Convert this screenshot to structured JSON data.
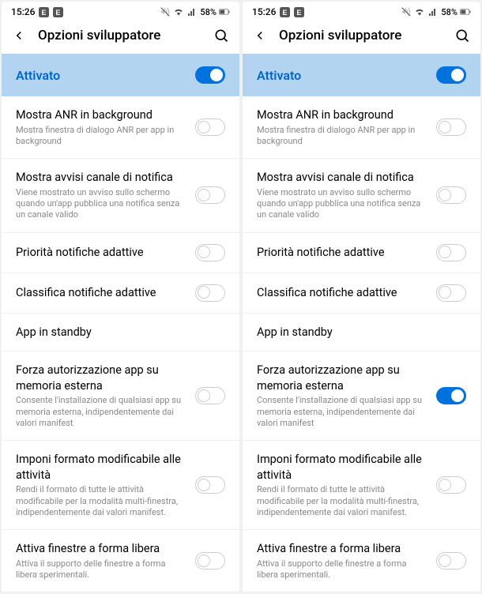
{
  "status": {
    "time": "15:26",
    "battery": "58%"
  },
  "header": {
    "title": "Opzioni sviluppatore"
  },
  "activated": {
    "label": "Attivato"
  },
  "settings": [
    {
      "title": "Mostra ANR in background",
      "desc": "Mostra finestra di dialogo ANR per app in background"
    },
    {
      "title": "Mostra avvisi canale di notifica",
      "desc": "Viene mostrato un avviso sullo schermo quando un'app pubblica una notifica senza un canale valido"
    },
    {
      "title": "Priorità notifiche adattive",
      "desc": ""
    },
    {
      "title": "Classifica notifiche adattive",
      "desc": ""
    },
    {
      "title": "App in standby",
      "desc": ""
    },
    {
      "title": "Forza autorizzazione app su memoria esterna",
      "desc": "Consente l'installazione di qualsiasi app su memoria esterna, indipendentemente dai valori manifest"
    },
    {
      "title": "Imponi formato modificabile alle attività",
      "desc": "Rendi il formato di tutte le attività modificabile per la modalità multi-finestra, indipendentemente dai valori manifest."
    },
    {
      "title": "Attiva finestre a forma libera",
      "desc": "Attiva il supporto delle finestre a forma libera sperimentali."
    }
  ],
  "screens": [
    {
      "toggles": [
        false,
        false,
        false,
        false,
        null,
        false,
        false,
        false
      ]
    },
    {
      "toggles": [
        false,
        false,
        false,
        false,
        null,
        true,
        false,
        false
      ]
    }
  ]
}
